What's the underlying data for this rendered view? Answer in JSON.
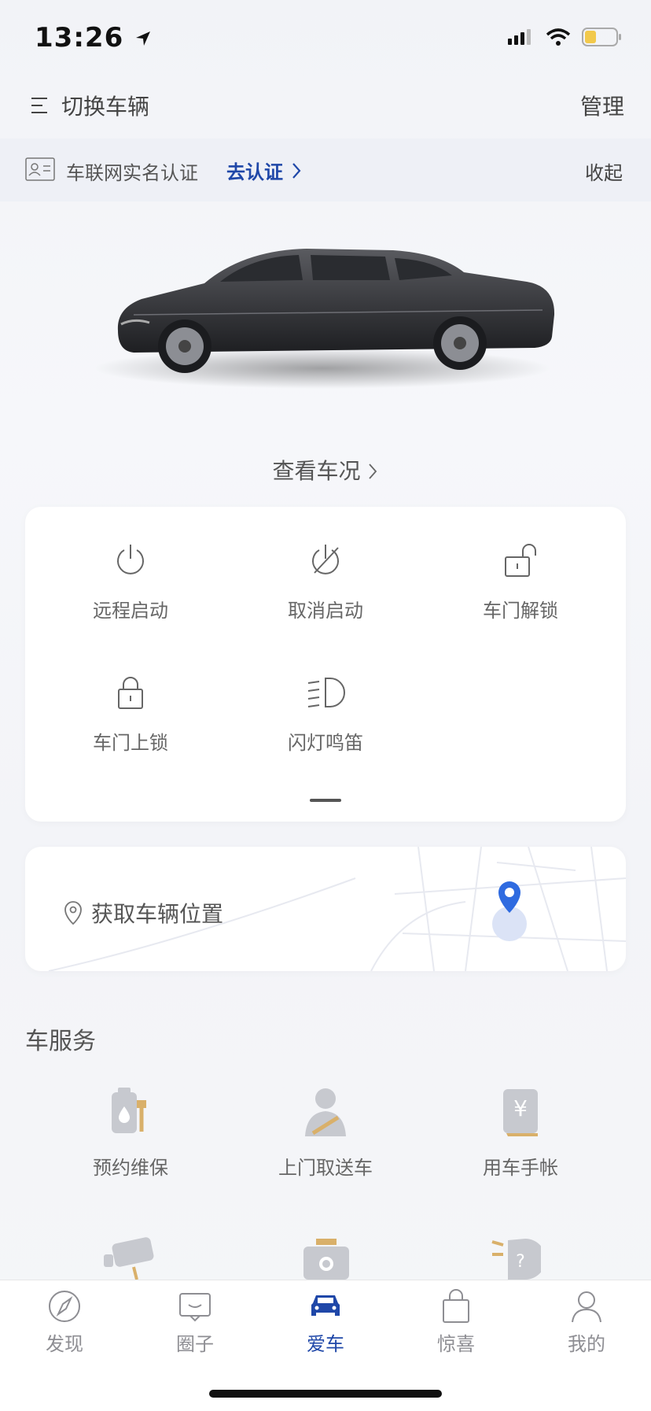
{
  "status_bar": {
    "time": "13:26"
  },
  "header": {
    "switch_label": "切换车辆",
    "manage_label": "管理"
  },
  "banner": {
    "text": "车联网实名认证",
    "link": "去认证",
    "collapse": "收起"
  },
  "car": {
    "view_status": "查看车况"
  },
  "controls": {
    "items": [
      {
        "label": "远程启动",
        "icon": "power-icon"
      },
      {
        "label": "取消启动",
        "icon": "power-off-icon"
      },
      {
        "label": "车门解锁",
        "icon": "unlock-icon"
      },
      {
        "label": "车门上锁",
        "icon": "lock-icon"
      },
      {
        "label": "闪灯鸣笛",
        "icon": "headlight-icon"
      }
    ]
  },
  "location": {
    "label": "获取车辆位置"
  },
  "services": {
    "title": "车服务",
    "items": [
      {
        "label": "预约维保",
        "icon": "oil-service-icon"
      },
      {
        "label": "上门取送车",
        "icon": "driver-icon"
      },
      {
        "label": "用车手帐",
        "icon": "handbook-icon"
      }
    ]
  },
  "tabbar": {
    "items": [
      {
        "label": "发现",
        "icon": "compass-icon"
      },
      {
        "label": "圈子",
        "icon": "chat-icon"
      },
      {
        "label": "爱车",
        "icon": "car-icon"
      },
      {
        "label": "惊喜",
        "icon": "bag-icon"
      },
      {
        "label": "我的",
        "icon": "profile-icon"
      }
    ],
    "active_index": 2
  },
  "colors": {
    "accent": "#1f47a8",
    "text": "#333333",
    "muted": "#8e8e93"
  }
}
